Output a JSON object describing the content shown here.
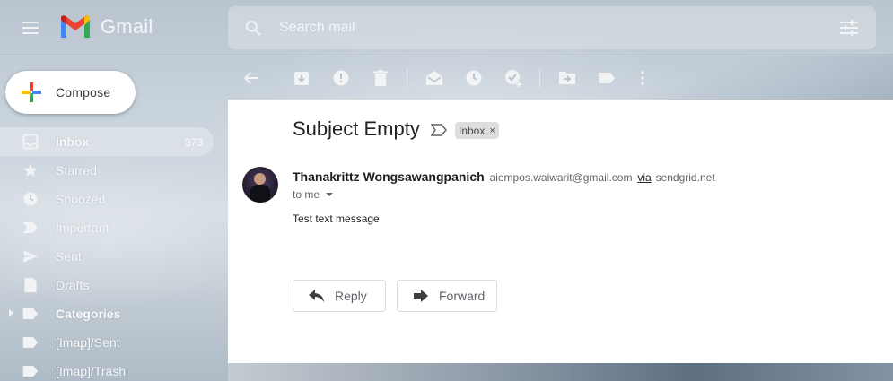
{
  "header": {
    "app_name": "Gmail",
    "search_placeholder": "Search mail"
  },
  "compose": {
    "label": "Compose"
  },
  "sidebar": {
    "items": [
      {
        "label": "Inbox",
        "count": "373",
        "icon": "inbox-icon",
        "active": true
      },
      {
        "label": "Starred",
        "icon": "star-icon"
      },
      {
        "label": "Snoozed",
        "icon": "clock-icon"
      },
      {
        "label": "Important",
        "icon": "label-important-icon"
      },
      {
        "label": "Sent",
        "icon": "send-icon"
      },
      {
        "label": "Drafts",
        "icon": "draft-icon"
      },
      {
        "label": "Categories",
        "icon": "label-icon",
        "expandable": true,
        "bold": true
      },
      {
        "label": "[Imap]/Sent",
        "icon": "label-icon"
      },
      {
        "label": "[Imap]/Trash",
        "icon": "label-icon"
      }
    ]
  },
  "toolbar": {
    "icons": [
      "back-arrow-icon",
      "archive-icon",
      "report-spam-icon",
      "delete-icon",
      "mark-unread-icon",
      "snooze-icon",
      "add-task-icon",
      "move-to-icon",
      "labels-icon",
      "more-vert-icon"
    ]
  },
  "message": {
    "subject": "Subject Empty",
    "label_chip": "Inbox",
    "label_chip_close": "×",
    "sender_name": "Thanakrittz Wongsawangpanich",
    "sender_email": "aiempos.waiwarit@gmail.com",
    "via_text": "via",
    "via_domain": "sendgrid.net",
    "to_text": "to me",
    "body": "Test text message",
    "reply_label": "Reply",
    "forward_label": "Forward"
  },
  "colors": {
    "sidebar_text": "#f8f9fa",
    "panel_bg": "#ffffff",
    "chip_bg": "#dddddd"
  }
}
